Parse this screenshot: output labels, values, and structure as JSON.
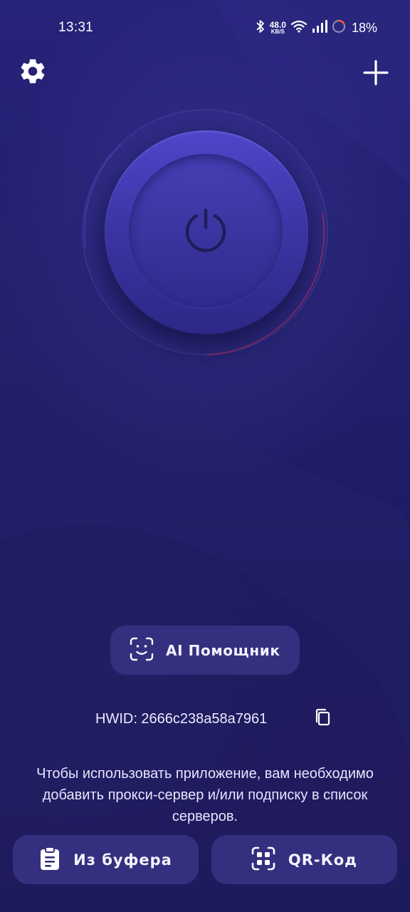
{
  "status_bar": {
    "time": "13:31",
    "net_speed_value": "48.0",
    "net_speed_unit": "KB/S",
    "battery_percent": "18%",
    "icons": [
      "bluetooth-icon",
      "wifi-icon",
      "signal-icon",
      "battery-ring-icon"
    ]
  },
  "header": {
    "settings_icon": "gear-icon",
    "add_icon": "plus-icon"
  },
  "power": {
    "icon": "power-icon",
    "state": "disconnected"
  },
  "ai_assistant": {
    "label": "AI Помощник",
    "icon": "face-scan-icon"
  },
  "hwid": {
    "text": "HWID: 2666c238a58a7961",
    "copy_icon": "copy-icon"
  },
  "info_text": "Чтобы использовать приложение, вам необходимо добавить прокси-сервер и/или подписку в список серверов.",
  "buttons": {
    "clipboard_label": "Из буфера",
    "clipboard_icon": "clipboard-icon",
    "qr_label": "QR-Код",
    "qr_icon": "qr-scan-icon"
  },
  "colors": {
    "background": "#1d1a5c",
    "button_bg": "#34307f",
    "power_disc": "#4d47c9",
    "power_icon": "#1f1c5a",
    "ring_accent": "#c0305a"
  }
}
